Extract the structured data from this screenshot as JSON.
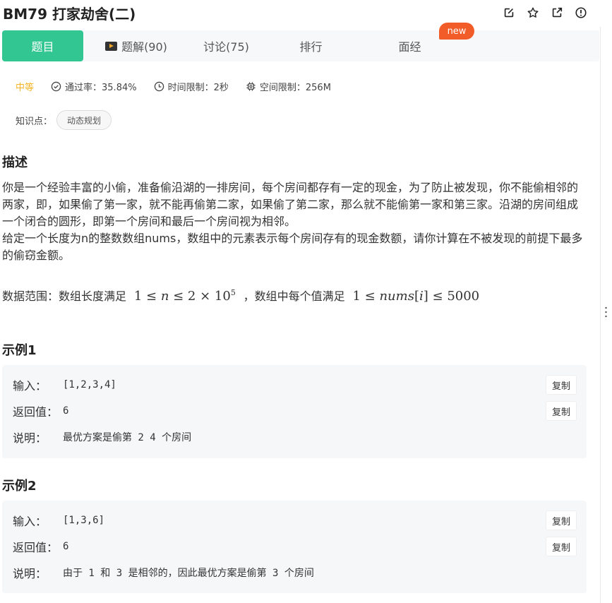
{
  "header": {
    "title": "BM79  打家劫舍(二)",
    "icons": [
      "edit-icon",
      "star-icon",
      "share-icon",
      "report-icon"
    ]
  },
  "tabs": [
    {
      "label": "题目",
      "active": true
    },
    {
      "label": "题解(90)",
      "icon": "video-icon"
    },
    {
      "label": "讨论(75)"
    },
    {
      "label": "排行"
    },
    {
      "label": "面经"
    }
  ],
  "badge": "new",
  "meta": {
    "difficulty": "中等",
    "pass_rate": "通过率：35.84%",
    "time_limit": "时间限制：2秒",
    "space_limit": "空间限制：256M"
  },
  "knowledge": {
    "label": "知识点：",
    "tag": "动态规划"
  },
  "description": {
    "heading": "描述",
    "para1": "你是一个经验丰富的小偷，准备偷沿湖的一排房间，每个房间都存有一定的现金，为了防止被发现，你不能偷相邻的两家，即，如果偷了第一家，就不能再偷第二家，如果偷了第二家，那么就不能偷第一家和第三家。沿湖的房间组成一个闭合的圆形，即第一个房间和最后一个房间视为相邻。",
    "para2": "给定一个长度为n的整数数组nums，数组中的元素表示每个房间存有的现金数额，请你计算在不被发现的前提下最多的偷窃金额。",
    "range_prefix": "数据范围：数组长度满足",
    "range_mid": "，数组中每个值满足"
  },
  "examples": [
    {
      "heading": "示例1",
      "input_label": "输入：",
      "input": "[1,2,3,4]",
      "output_label": "返回值：",
      "output": "6",
      "note_label": "说明：",
      "note": "最优方案是偷第 2 4 个房间",
      "copy": "复制"
    },
    {
      "heading": "示例2",
      "input_label": "输入：",
      "input": "[1,3,6]",
      "output_label": "返回值：",
      "output": "6",
      "note_label": "说明：",
      "note": "由于 1 和 3 是相邻的，因此最优方案是偷第 3 个房间",
      "copy": "复制"
    }
  ],
  "colors": {
    "accent": "#32c692",
    "badge": "#f25c28",
    "difficulty": "#f5b324"
  }
}
